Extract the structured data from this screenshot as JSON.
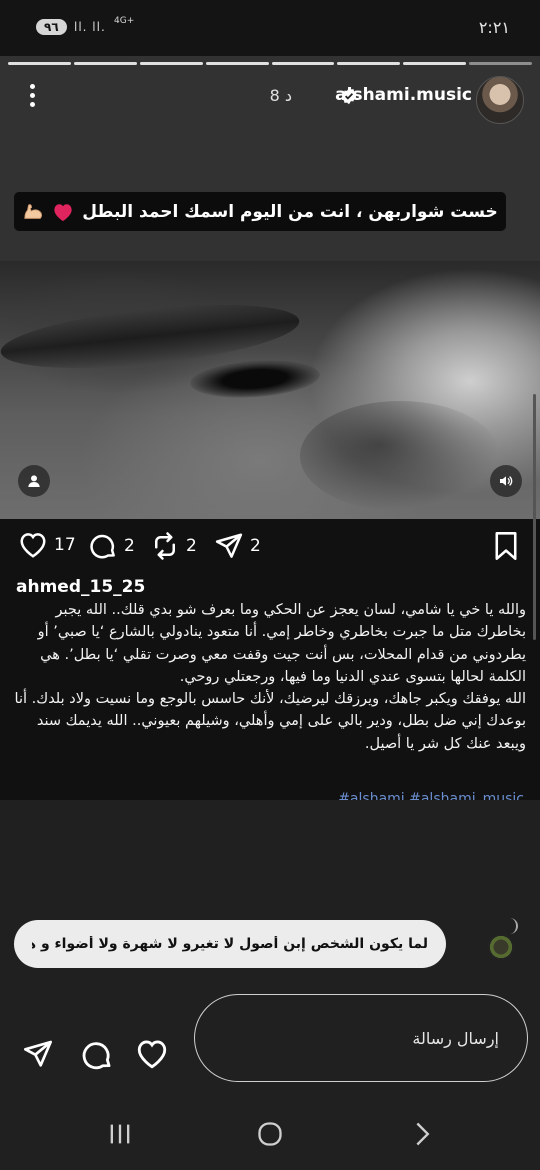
{
  "status_bar": {
    "time": "٢:٢١",
    "battery": "٩٦",
    "signal": "ll. ll.",
    "network": "4G+"
  },
  "story": {
    "progress_segments": 8,
    "username": "alshami.music",
    "time_ago": "8 د",
    "caption": "خست شواربهن ، انت من اليوم اسمك احمد البطل"
  },
  "post": {
    "likes": "17",
    "comments": "2",
    "reposts": "2",
    "shares": "2",
    "author": "ahmed_15_25",
    "text": "والله يا خي يا شامي، لسان يعجز عن الحكي وما بعرف شو بدي قلك.. الله يجبر بخاطرك متل ما جبرت بخاطري وخاطر إمي. أنا متعود ينادولي بالشارع ‘يا صبي’ أو يطردوني من قدام المحلات، بس أنت جيت وقفت معي وصرت تقلي ‘يا بطل’. هي الكلمة لحالها بتسوى عندي الدنيا وما فيها، ورجعتلي روحي.\nالله يوفقك ويكبر جاهك، ويرزقك ليرضيك، لأنك حاسس بالوجع وما نسيت ولاد بلدك. أنا بوعدك إني ضل بطل، ودير بالي على إمي وأهلي، وشيلهم بعيوني.. الله يديمك سند ويبعد عنك كل شر يا أصيل.",
    "hashtags": "#alshami #alshami_music"
  },
  "reply_preview": "لما يكون الشخص إبن أصول لا تغيرو لا شهرة ولا أضواء و هاد ...",
  "message_input": {
    "placeholder": "إرسال رسالة"
  },
  "colors": {
    "background": "#202020",
    "post_panel": "#111111",
    "heart_emoji": "#e0245e",
    "hashtag": "#6a8ecf"
  }
}
